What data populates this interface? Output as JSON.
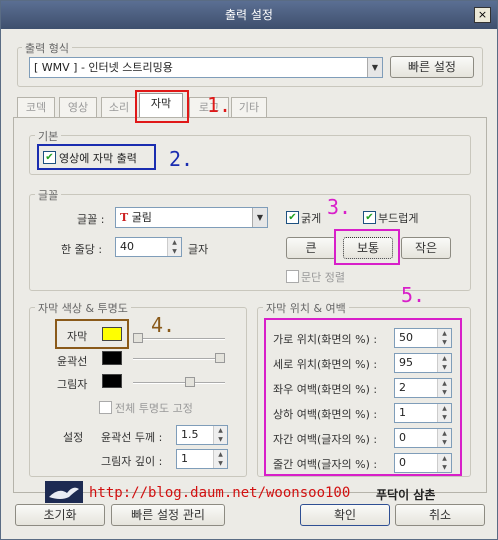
{
  "window": {
    "title": "출력 설정",
    "close": "×"
  },
  "format": {
    "group_title": "출력 형식",
    "selected": "[ WMV ] - 인터넷 스트리밍용",
    "quick_settings": "빠른 설정"
  },
  "tabs": [
    "코덱",
    "영상",
    "소리",
    "자막",
    "로고",
    "기타"
  ],
  "basic": {
    "group_title": "기본",
    "show_subtitle": "영상에 자막 출력"
  },
  "font": {
    "group_title": "글꼴",
    "font_label": "글꼴 :",
    "font_value": "굴림",
    "chars_label": "한 줄당 :",
    "chars_value": "40",
    "chars_unit": "글자",
    "bold": "굵게",
    "smooth": "부드럽게",
    "size_large": "큰",
    "size_normal": "보통",
    "size_small": "작은",
    "align": "문단 정렬"
  },
  "color": {
    "group_title": "자막 색상 & 투명도",
    "subtitle": "자막",
    "outline": "윤곽선",
    "shadow": "그림자",
    "all_opacity": "전체 투명도 고정",
    "settings": "설정",
    "outline_thickness": "윤곽선 두께 :",
    "outline_thickness_value": "1.5",
    "shadow_depth": "그림자 깊이 :",
    "shadow_depth_value": "1",
    "subtitle_color": "#ffff00",
    "outline_color": "#000000",
    "shadow_color": "#000000"
  },
  "position": {
    "group_title": "자막 위치 & 여백",
    "rows": [
      {
        "label": "가로 위치(화면의 %) :",
        "value": "50"
      },
      {
        "label": "세로 위치(화면의 %) :",
        "value": "95"
      },
      {
        "label": "좌우 여백(화면의 %) :",
        "value": "2"
      },
      {
        "label": "상하 여백(화면의 %) :",
        "value": "1"
      },
      {
        "label": "자간 여백(글자의 %) :",
        "value": "0"
      },
      {
        "label": "줄간 여백(글자의 %) :",
        "value": "0"
      }
    ]
  },
  "watermark": {
    "url": "http://blog.daum.net/woonsoo100",
    "name": "푸닥이 삼촌"
  },
  "footer": {
    "reset": "초기화",
    "manage": "빠른 설정 관리",
    "ok": "확인",
    "cancel": "취소"
  },
  "annotations": [
    "1.",
    "2.",
    "3.",
    "4.",
    "5."
  ]
}
